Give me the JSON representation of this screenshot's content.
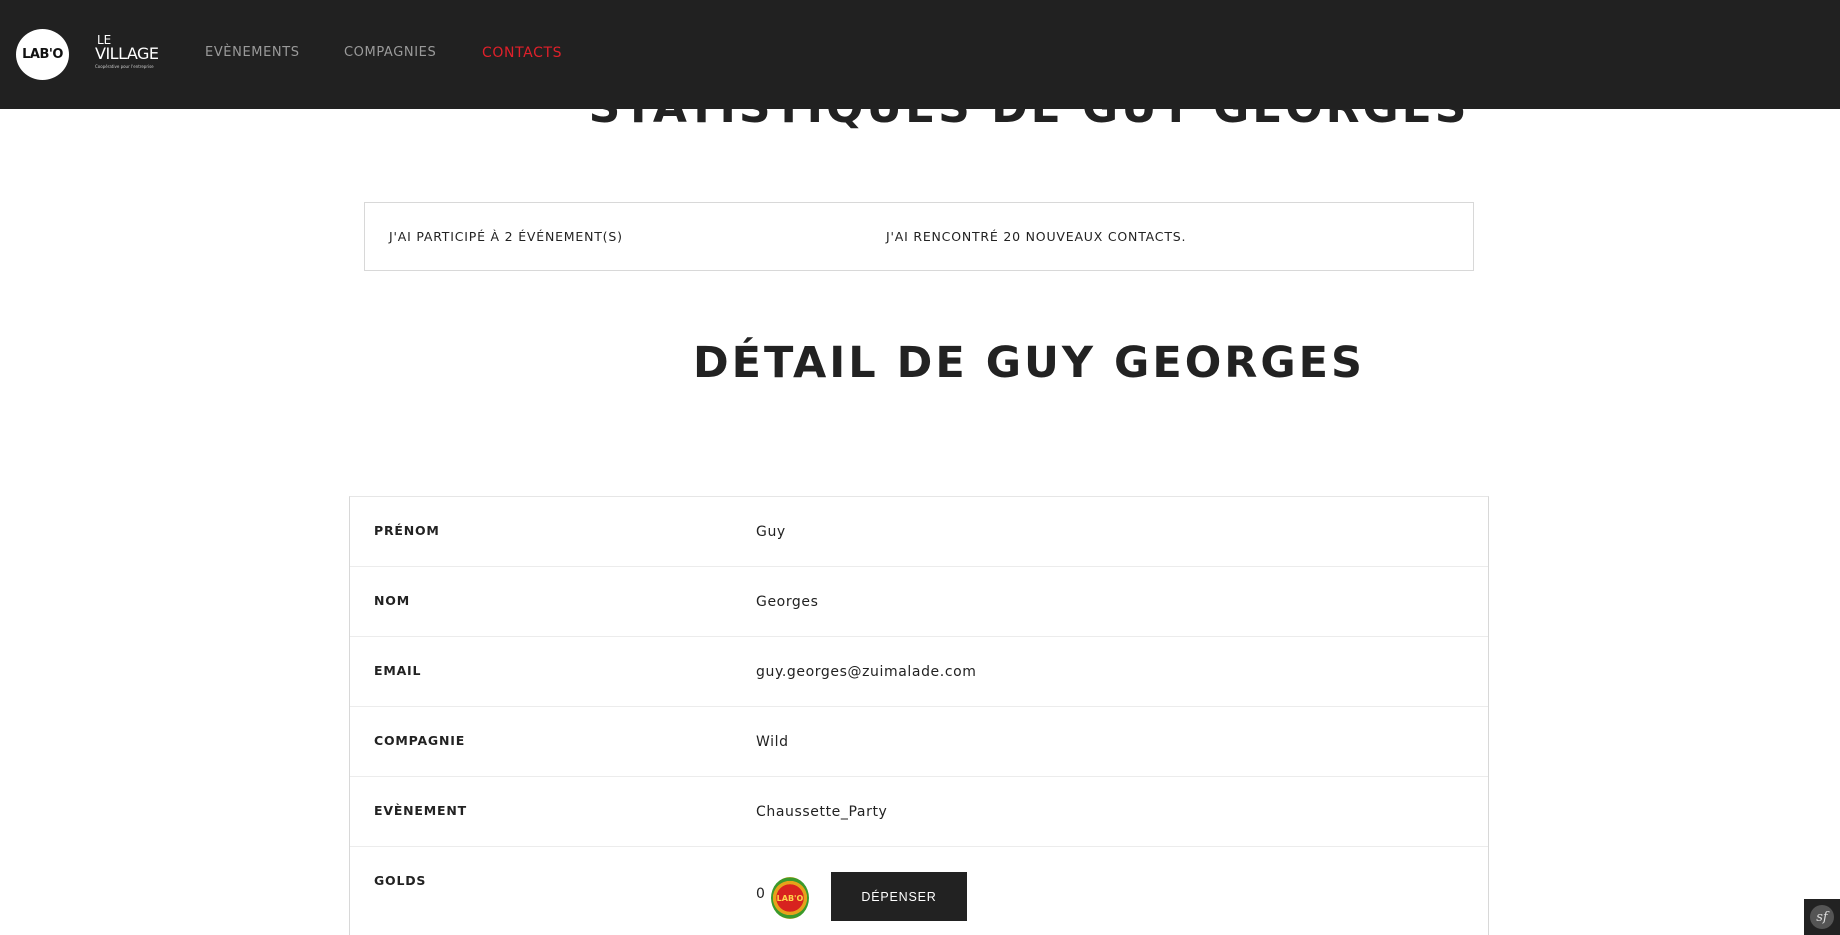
{
  "nav": {
    "logo_labo": "LAB'O",
    "logo_village_le": "LE",
    "logo_village_main": "VILLAGE",
    "logo_village_tag": "Coopérative pour l'entreprise",
    "links": [
      {
        "label": "EVÈNEMENTS",
        "active": false
      },
      {
        "label": "COMPAGNIES",
        "active": false
      },
      {
        "label": "CONTACTS",
        "active": true
      }
    ],
    "active_color": "#e0202a"
  },
  "stats": {
    "title": "STATISTIQUES DE GUY GEORGES",
    "events_text": "J'AI PARTICIPÉ À 2 ÉVÉNEMENT(S)",
    "contacts_text": "J'AI RENCONTRÉ 20 NOUVEAUX CONTACTS."
  },
  "detail": {
    "title": "DÉTAIL DE GUY GEORGES",
    "rows": [
      {
        "label": "PRÉNOM",
        "value": "Guy"
      },
      {
        "label": "NOM",
        "value": "Georges"
      },
      {
        "label": "EMAIL",
        "value": "guy.georges@zuimalade.com"
      },
      {
        "label": "COMPAGNIE",
        "value": "Wild"
      },
      {
        "label": "EVÈNEMENT",
        "value": "Chaussette_Party"
      }
    ],
    "golds": {
      "label": "GOLDS",
      "count": "0",
      "coin_text": "LAB'O",
      "button_label": "DÉPENSER"
    }
  },
  "debug": {
    "badge_icon": "symfony-icon",
    "badge_text": "sf"
  }
}
